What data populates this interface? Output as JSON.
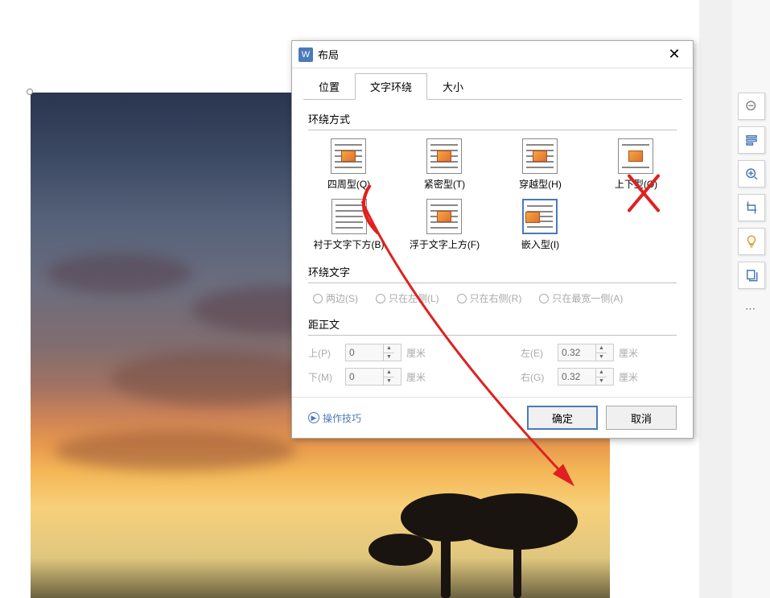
{
  "dialog": {
    "title": "布局",
    "tabs": {
      "position": "位置",
      "wrap": "文字环绕",
      "size": "大小"
    },
    "sections": {
      "wrap_style": "环绕方式",
      "wrap_text": "环绕文字",
      "distance": "距正文"
    },
    "wrap_options": {
      "square": "四周型(Q)",
      "tight": "紧密型(T)",
      "through": "穿越型(H)",
      "topbottom": "上下型(O)",
      "behind": "衬于文字下方(B)",
      "front": "浮于文字上方(F)",
      "inline": "嵌入型(I)"
    },
    "wrap_text_options": {
      "both": "两边(S)",
      "left": "只在左侧(L)",
      "right": "只在右侧(R)",
      "largest": "只在最宽一侧(A)"
    },
    "distance_labels": {
      "top": "上(P)",
      "bottom": "下(M)",
      "left": "左(E)",
      "right": "右(G)",
      "unit": "厘米"
    },
    "distance_values": {
      "top": "0",
      "bottom": "0",
      "left": "0.32",
      "right": "0.32"
    },
    "footer": {
      "tips": "操作技巧",
      "ok": "确定",
      "cancel": "取消"
    }
  },
  "sidebar_dots": "⋯"
}
